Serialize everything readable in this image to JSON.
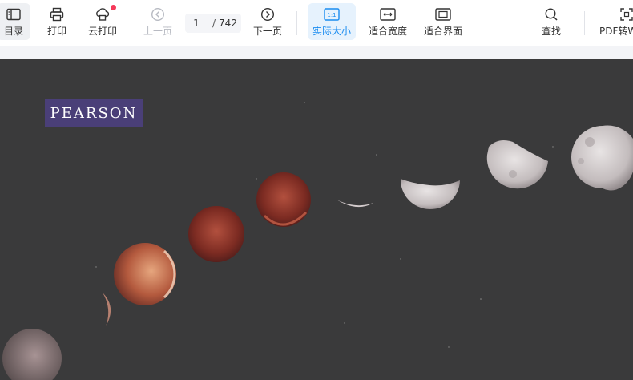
{
  "toolbar": {
    "toc_label": "目录",
    "print_label": "打印",
    "cloud_print_label": "云打印",
    "prev_label": "上一页",
    "current_page": "1",
    "page_separator": "/",
    "total_pages": "742",
    "next_label": "下一页",
    "actual_size_label": "实际大小",
    "actual_size_icon_text": "1:1",
    "fit_width_label": "适合宽度",
    "fit_page_label": "适合界面",
    "find_label": "查找",
    "pdf_convert_label": "PDF转W"
  },
  "document": {
    "logo_text": "PEARSON"
  },
  "colors": {
    "accent": "#1a8cf0",
    "active_bg": "#e6f2fd",
    "badge": "#f53a5a",
    "page_bg": "#3a3a3b",
    "logo_bg": "#4a3f78"
  }
}
